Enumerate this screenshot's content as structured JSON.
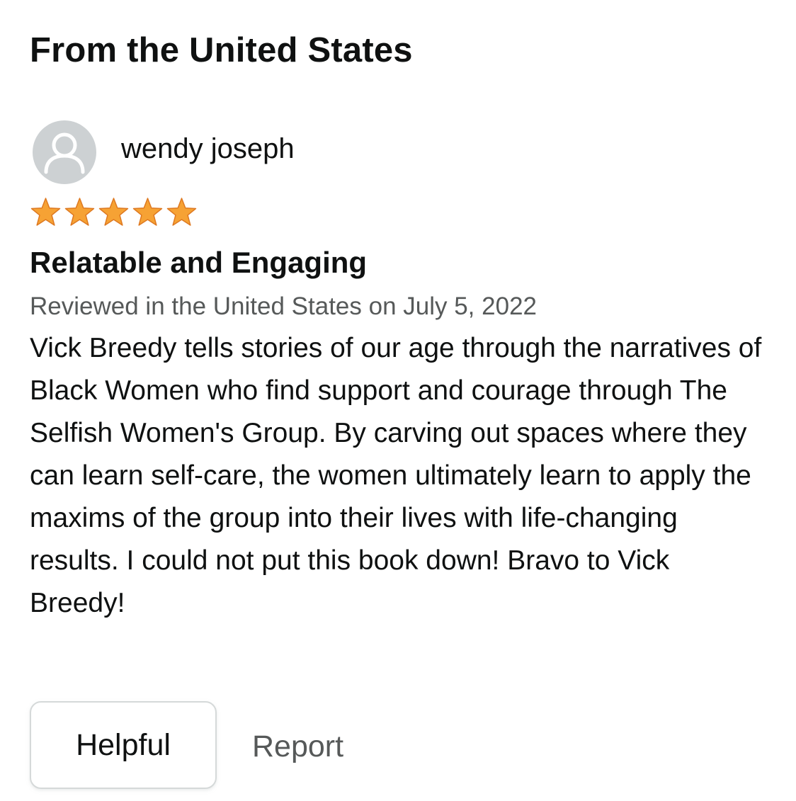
{
  "section": {
    "heading": "From the United States"
  },
  "review": {
    "reviewer_name": "wendy joseph",
    "avatar_icon": "person-silhouette-icon",
    "rating": 5,
    "rating_max": 5,
    "star_color": "#f6a234",
    "star_outline_color": "#de7921",
    "title": "Relatable and Engaging",
    "date_line": "Reviewed in the United States on July 5, 2022",
    "body": "Vick Breedy tells stories of our age through the narratives of Black Women who find support and courage through The Selfish Women's Group. By carving out spaces where they can learn self-care, the women ultimately learn to apply the maxims of the group into their lives with life-changing results. I could not put this book down! Bravo to Vick Breedy!"
  },
  "actions": {
    "helpful_label": "Helpful",
    "report_label": "Report"
  }
}
